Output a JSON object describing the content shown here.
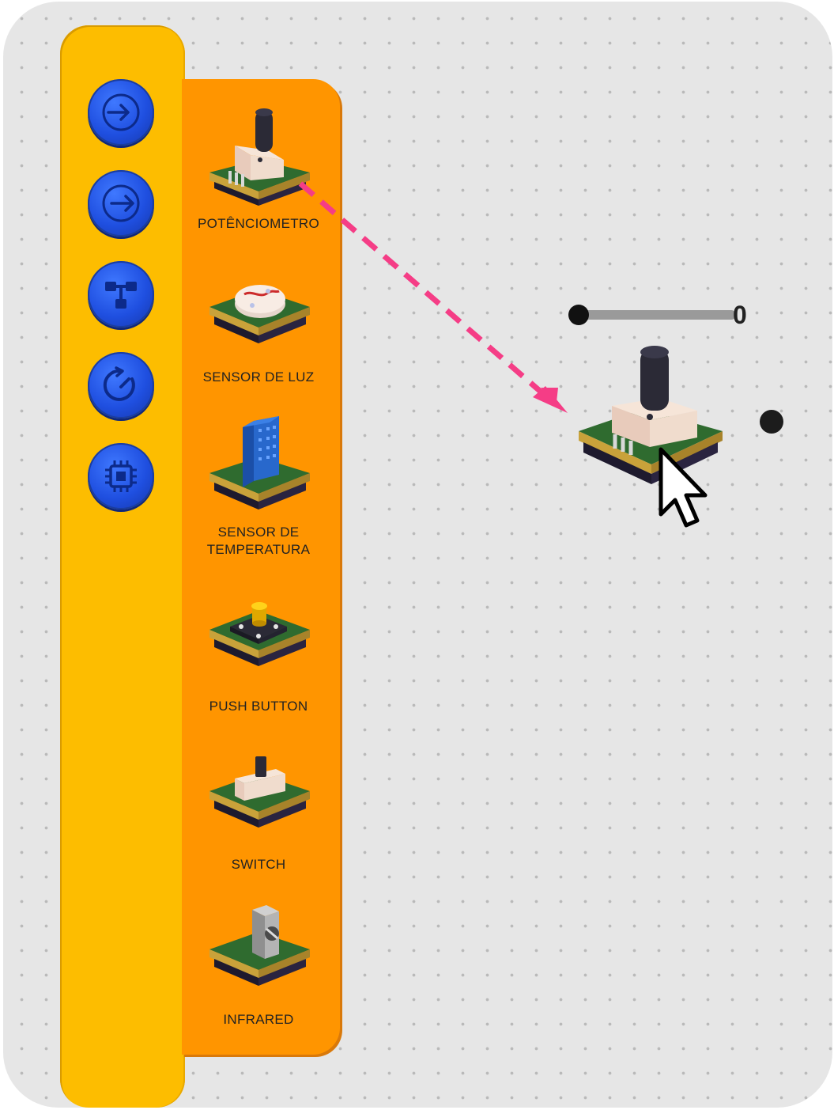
{
  "categories": [
    {
      "icon": "arrow-in-icon"
    },
    {
      "icon": "arrow-out-icon"
    },
    {
      "icon": "flow-icon"
    },
    {
      "icon": "timer-icon"
    },
    {
      "icon": "chip-icon"
    }
  ],
  "components": [
    {
      "label": "POTÊNCIOMETRO",
      "icon": "potentiometer-icon"
    },
    {
      "label": "SENSOR DE LUZ",
      "icon": "light-sensor-icon"
    },
    {
      "label": "SENSOR DE\nTEMPERATURA",
      "icon": "temperature-sensor-icon"
    },
    {
      "label": "PUSH BUTTON",
      "icon": "push-button-icon"
    },
    {
      "label": "SWITCH",
      "icon": "switch-icon"
    },
    {
      "label": "INFRARED",
      "icon": "infrared-icon"
    }
  ],
  "placed_block": {
    "icon": "potentiometer-icon",
    "slider_value": "0"
  },
  "colors": {
    "canvas": "#e6e6e6",
    "category_bar": "#fdbd00",
    "drawer": "#ff9500",
    "category_button": "#1f4fe0",
    "drag_arrow": "#f53d86"
  }
}
